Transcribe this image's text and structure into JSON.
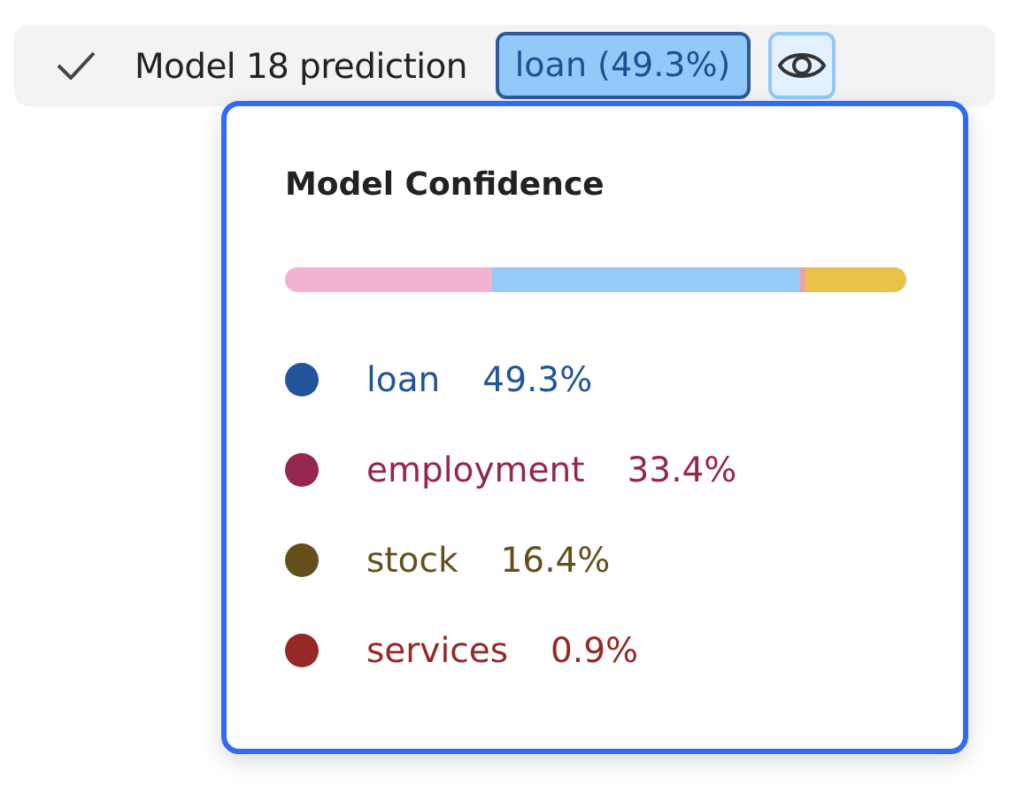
{
  "prediction": {
    "label": "Model 18 prediction",
    "badge": "loan (49.3%)"
  },
  "popover": {
    "title": "Model Confidence",
    "bar": [
      {
        "color": "#f2b3d3"
      },
      {
        "color": "#95cbf7"
      },
      {
        "color": "#f0a0a0"
      },
      {
        "color": "#eac24a"
      }
    ],
    "classes": [
      {
        "name": "loan",
        "value": "49.3%",
        "color": "#22549a"
      },
      {
        "name": "employment",
        "value": "33.4%",
        "color": "#952650"
      },
      {
        "name": "stock",
        "value": "16.4%",
        "color": "#644f1a"
      },
      {
        "name": "services",
        "value": "0.9%",
        "color": "#962825"
      }
    ]
  }
}
